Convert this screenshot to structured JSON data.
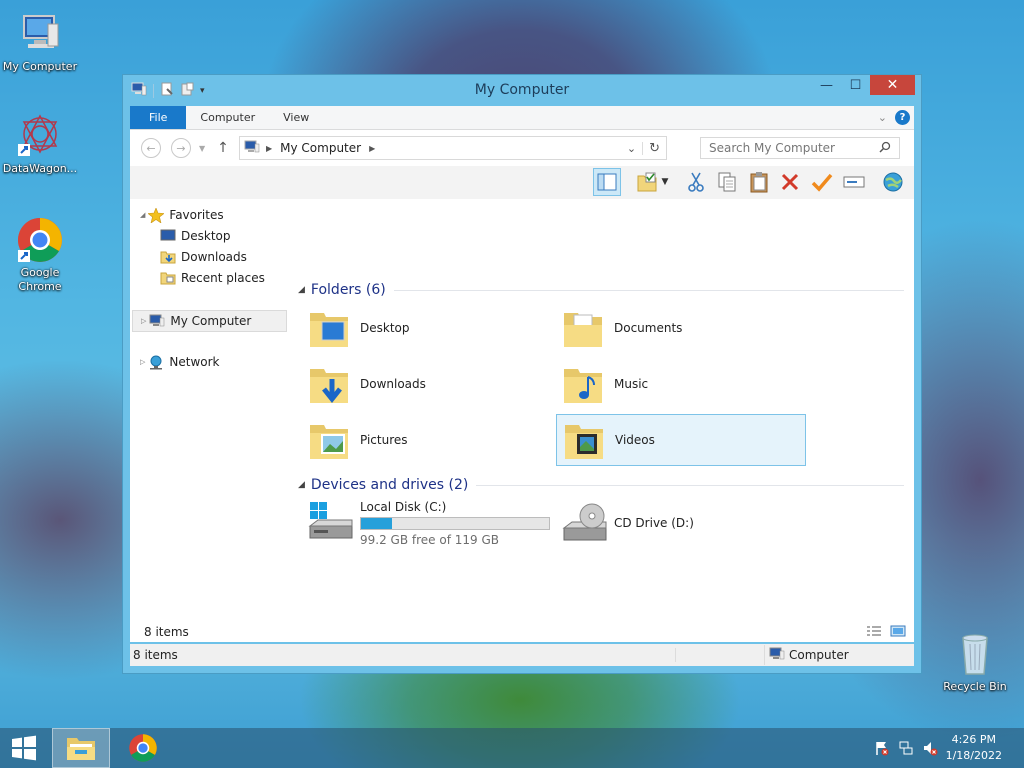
{
  "desktop": {
    "icons": [
      {
        "label": "My Computer",
        "icon": "computer-icon"
      },
      {
        "label": "DataWagon...",
        "icon": "datawagon-icon"
      },
      {
        "label": "Google Chrome",
        "icon": "chrome-icon"
      },
      {
        "label": "Recycle Bin",
        "icon": "recycle-bin-icon"
      }
    ]
  },
  "window": {
    "title": "My Computer",
    "tabs": [
      "File",
      "Computer",
      "View"
    ],
    "address": {
      "path": "My Computer"
    },
    "search": {
      "placeholder": "Search My Computer"
    },
    "nav": {
      "favorites": "Favorites",
      "items": [
        "Desktop",
        "Downloads",
        "Recent places"
      ],
      "computer": "My Computer",
      "network": "Network"
    },
    "folders": {
      "header": "Folders (6)",
      "items": [
        "Desktop",
        "Documents",
        "Downloads",
        "Music",
        "Pictures",
        "Videos"
      ],
      "selected": "Videos"
    },
    "drives": {
      "header": "Devices and drives (2)",
      "local": {
        "name": "Local Disk (C:)",
        "free_text": "99.2 GB free of 119 GB",
        "used_fraction": 0.166
      },
      "cd": {
        "name": "CD Drive (D:)"
      }
    },
    "status_inner": "8 items",
    "status_left": "8 items",
    "status_right": "Computer"
  },
  "taskbar": {
    "time": "4:26 PM",
    "date": "1/18/2022"
  },
  "colors": {
    "accent": "#1979ca",
    "selection": "#e5f3fb",
    "close": "#c7463c",
    "progress": "#26a0da"
  }
}
